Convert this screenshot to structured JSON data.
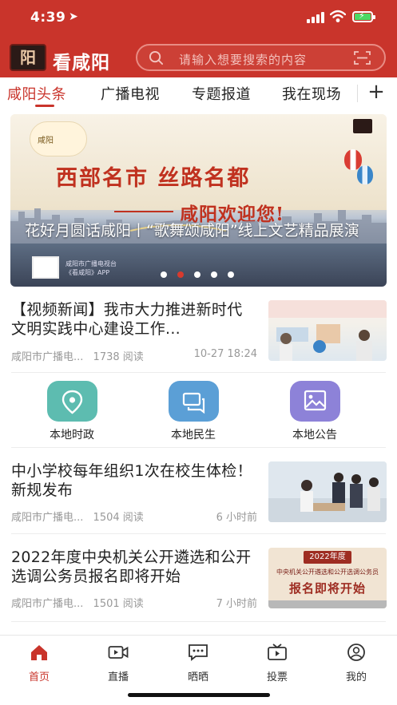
{
  "status_bar": {
    "time": "4:39"
  },
  "app": {
    "name": "看咸阳",
    "logo_glyph": "阳"
  },
  "search": {
    "placeholder": "请输入想要搜索的内容"
  },
  "tabs": [
    {
      "label": "咸阳头条",
      "active": true
    },
    {
      "label": "广播电视",
      "active": false
    },
    {
      "label": "专题报道",
      "active": false
    },
    {
      "label": "我在现场",
      "active": false
    }
  ],
  "tab_more": "+",
  "banner": {
    "slogan_main": "西部名市  丝路名都",
    "slogan_sub": "咸阳欢迎您!",
    "caption": "花好月圆话咸阳丨“歌舞颂咸阳”线上文艺精品展演",
    "badge_text": "咸阳",
    "credit_line1": "咸阳市广播电视台",
    "credit_line2": "《看咸阳》APP",
    "dots_total": 5,
    "dots_active_index": 1
  },
  "news": [
    {
      "title": "【视频新闻】我市大力推进新时代文明实践中心建设工作...",
      "source": "咸阳市广播电...",
      "reads": "1738 阅读",
      "time": "10-27 18:24"
    },
    {
      "title": "中小学校每年组织1次在校生体检！新规发布",
      "source": "咸阳市广播电...",
      "reads": "1504 阅读",
      "time": "6 小时前"
    },
    {
      "title": "2022年度中央机关公开遴选和公开选调公务员报名即将开始",
      "source": "咸阳市广播电...",
      "reads": "1501 阅读",
      "time": "7 小时前",
      "thumb_year": "2022年度",
      "thumb_line": "中央机关公开遴选和公开选调公务员",
      "thumb_big": "报名即将开始"
    }
  ],
  "quick_links": [
    {
      "label": "本地时政",
      "color": "#5dbcb0",
      "icon": "location-pin-icon"
    },
    {
      "label": "本地民生",
      "color": "#5b9fd6",
      "icon": "chat-bubbles-icon"
    },
    {
      "label": "本地公告",
      "color": "#8d82d8",
      "icon": "image-icon"
    }
  ],
  "bottom_nav": [
    {
      "label": "首页",
      "icon": "home-icon",
      "active": true
    },
    {
      "label": "直播",
      "icon": "video-camera-icon",
      "active": false
    },
    {
      "label": "晒晒",
      "icon": "message-icon",
      "active": false
    },
    {
      "label": "投票",
      "icon": "tv-icon",
      "active": false
    },
    {
      "label": "我的",
      "icon": "user-icon",
      "active": false
    }
  ],
  "colors": {
    "brand": "#c9342b",
    "text": "#222222",
    "muted": "#999999"
  }
}
